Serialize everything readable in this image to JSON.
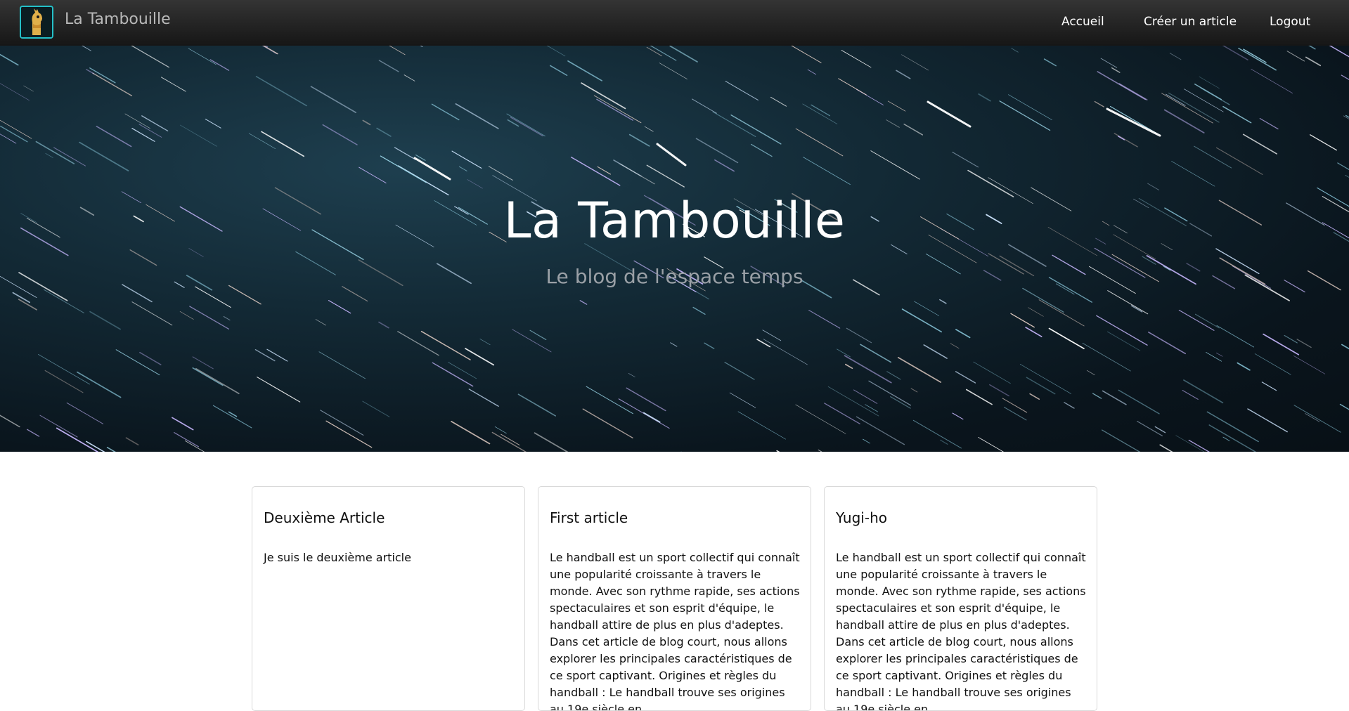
{
  "navbar": {
    "brand": "La Tambouille",
    "links": [
      {
        "label": "Accueil"
      },
      {
        "label": "Créer un article"
      },
      {
        "label": "Logout"
      }
    ]
  },
  "hero": {
    "title": "La Tambouille",
    "subtitle": "Le blog de l'espace temps"
  },
  "articles": [
    {
      "title": "Deuxième Article",
      "excerpt": "Je suis le deuxième article"
    },
    {
      "title": "First article",
      "excerpt": "Le handball est un sport collectif qui connaît une popularité croissante à travers le monde. Avec son rythme rapide, ses actions spectaculaires et son esprit d'équipe, le handball attire de plus en plus d'adeptes. Dans cet article de blog court, nous allons explorer les principales caractéristiques de ce sport captivant. Origines et règles du handball : Le handball trouve ses origines au 19e siècle en"
    },
    {
      "title": "Yugi-ho",
      "excerpt": "Le handball est un sport collectif qui connaît une popularité croissante à travers le monde. Avec son rythme rapide, ses actions spectaculaires et son esprit d'équipe, le handball attire de plus en plus d'adeptes. Dans cet article de blog court, nous allons explorer les principales caractéristiques de ce sport captivant. Origines et règles du handball : Le handball trouve ses origines au 19e siècle en"
    }
  ],
  "icons": {
    "brand_logo": "llama-logo-icon"
  },
  "colors": {
    "navbar": "#1f1f1f",
    "logo_border": "#24c0c8",
    "hero_sky": "#132a36"
  }
}
